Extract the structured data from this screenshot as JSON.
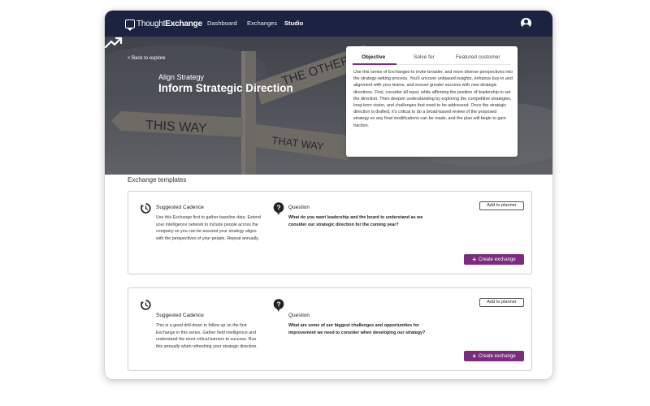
{
  "brand": {
    "logo_regular": "Thought",
    "logo_bold": "Exchange"
  },
  "nav": {
    "links": [
      "Dashboard",
      "Exchanges",
      "Studio"
    ]
  },
  "hero": {
    "back_link": "< Back to explore",
    "subtitle": "Align Strategy",
    "title": "Inform Strategic Direction",
    "sign_texts": [
      "THIS WAY",
      "THE OTHER WAY",
      "THAT WAY"
    ]
  },
  "info_card": {
    "tabs": [
      "Objective",
      "Solve for",
      "Featured customer"
    ],
    "body": "Use this series of Exchanges to invite broader, and more diverse perspectives into the strategy-setting process. You'll uncover unbiased insights, enhance buy-in and alignment with your teams, and ensure greater success with new strategic directions. First, consider all input, while affirming the position of leadership to set the direction. Then deepen understanding by exploring the competitive strategies, long-term vision, and challenges that need to be addressed. Once the strategic direction is drafted, it's critical to do a broad-based review of the proposed strategy so any final modifications can be made, and the plan will begin to gain traction."
  },
  "templates": {
    "section_title": "Exchange templates",
    "items": [
      {
        "cadence_label": "Suggested Cadence",
        "cadence_text": "Use this Exchange first to gather baseline data. Extend your intelligence network to include people across the company so you can be assured your strategy aligns with the perspectives of your people. Repeat annually.",
        "question_label": "Question",
        "question_text": "What do you want leadership and the board to understand as we consider our strategic direction for the coming year?",
        "planner_label": "Add to planner",
        "create_label": "Create exchange"
      },
      {
        "cadence_label": "Suggested Cadence",
        "cadence_text": "This is a good drill-down to follow up on the first Exchange in this series. Gather field intelligence and understand the most critical barriers to success. Run this annually when refreshing your strategic direction.",
        "question_label": "Question",
        "question_text": "What are some of our biggest challenges and opportunities for improvement we need to consider when developing our strategy?",
        "planner_label": "Add to planner",
        "create_label": "Create exchange"
      }
    ]
  },
  "colors": {
    "nav_bg": "#1c2340",
    "accent": "#7b2c7f",
    "card_border": "#cfcfcf"
  },
  "icons": [
    "logo-mark-icon",
    "user-avatar-icon",
    "trend-up-icon",
    "clock-refresh-icon",
    "question-bubble-icon",
    "plus-icon"
  ]
}
